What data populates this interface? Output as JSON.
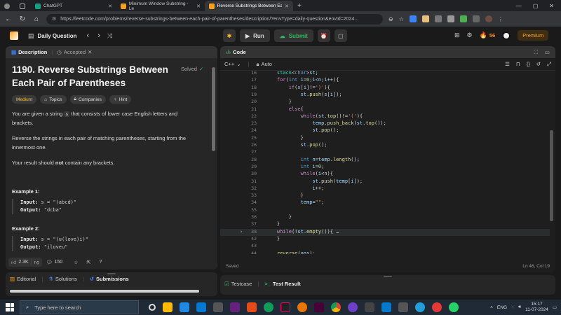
{
  "browser": {
    "tabs": [
      {
        "label": "ChatGPT",
        "color": "#10a37f"
      },
      {
        "label": "Minimum Window Substring - Le",
        "color": "#f89f1b"
      },
      {
        "label": "Reverse Substrings Between Eac",
        "color": "#f89f1b",
        "active": true
      }
    ],
    "new_tab": "+",
    "url": "https://leetcode.com/problems/reverse-substrings-between-each-pair-of-parentheses/description/?envType=daily-question&envId=2024..."
  },
  "header": {
    "title": "Daily Question",
    "run_label": "Run",
    "submit_label": "Submit",
    "streak_count": "56",
    "premium_label": "Premium"
  },
  "left": {
    "tabs": {
      "description": "Description",
      "accepted": "Accepted"
    },
    "problem_title": "1190. Reverse Substrings Between Each Pair of Parentheses",
    "status": "Solved",
    "chips": [
      "Medium",
      "Topics",
      "Companies",
      "Hint"
    ],
    "para1_a": "You are given a string ",
    "para1_code": "s",
    "para1_b": " that consists of lower case English letters and brackets.",
    "para2": "Reverse the strings in each pair of matching parentheses, starting from the innermost one.",
    "para3_a": "Your result should ",
    "para3_bold": "not",
    "para3_b": " contain any brackets.",
    "example1": {
      "title": "Example 1:",
      "input_label": "Input:",
      "input": "s = \"(abcd)\"",
      "output_label": "Output:",
      "output": "\"dcba\""
    },
    "example2": {
      "title": "Example 2:",
      "input_label": "Input:",
      "input": "s = \"(u(love)i)\"",
      "output_label": "Output:",
      "output": "\"iloveu\""
    },
    "likes": "2.3K",
    "comments": "150",
    "bottom_tabs": [
      "Editorial",
      "Solutions",
      "Submissions"
    ]
  },
  "code": {
    "title": "Code",
    "language": "C++",
    "auto": "Auto",
    "status": "Saved",
    "position": "Ln 46, Col 19",
    "lines": [
      {
        "n": "16",
        "t": "    stack<char>st;"
      },
      {
        "n": "17",
        "t": "    for(int i=0;i<n;i++){"
      },
      {
        "n": "18",
        "t": "        if(s[i]!=')'){"
      },
      {
        "n": "19",
        "t": "            st.push(s[i]);"
      },
      {
        "n": "20",
        "t": "        }"
      },
      {
        "n": "21",
        "t": "        else{"
      },
      {
        "n": "22",
        "t": "            while(st.top()!='('){"
      },
      {
        "n": "23",
        "t": "                temp.push_back(st.top());"
      },
      {
        "n": "24",
        "t": "                st.pop();"
      },
      {
        "n": "25",
        "t": "            }"
      },
      {
        "n": "26",
        "t": "            st.pop();"
      },
      {
        "n": "27",
        "t": ""
      },
      {
        "n": "28",
        "t": "            int n=temp.length();"
      },
      {
        "n": "29",
        "t": "            int i=0;"
      },
      {
        "n": "30",
        "t": "            while(i<n){"
      },
      {
        "n": "31",
        "t": "                st.push(temp[i]);"
      },
      {
        "n": "32",
        "t": "                i++;"
      },
      {
        "n": "33",
        "t": "            }"
      },
      {
        "n": "34",
        "t": "            temp=\"\";"
      },
      {
        "n": "35",
        "t": ""
      },
      {
        "n": "36",
        "t": "        }"
      },
      {
        "n": "37",
        "t": "    }"
      },
      {
        "n": "38",
        "t": "    while(!st.empty()){ …"
      },
      {
        "n": "42",
        "t": "    }"
      },
      {
        "n": "43",
        "t": ""
      },
      {
        "n": "44",
        "t": "    reverse(ans);"
      }
    ]
  },
  "testcase": {
    "tab1": "Testcase",
    "tab2": "Test Result"
  },
  "taskbar": {
    "search_placeholder": "Type here to search",
    "lang": "ENG",
    "time": "15:17",
    "date": "11-07-2024"
  }
}
